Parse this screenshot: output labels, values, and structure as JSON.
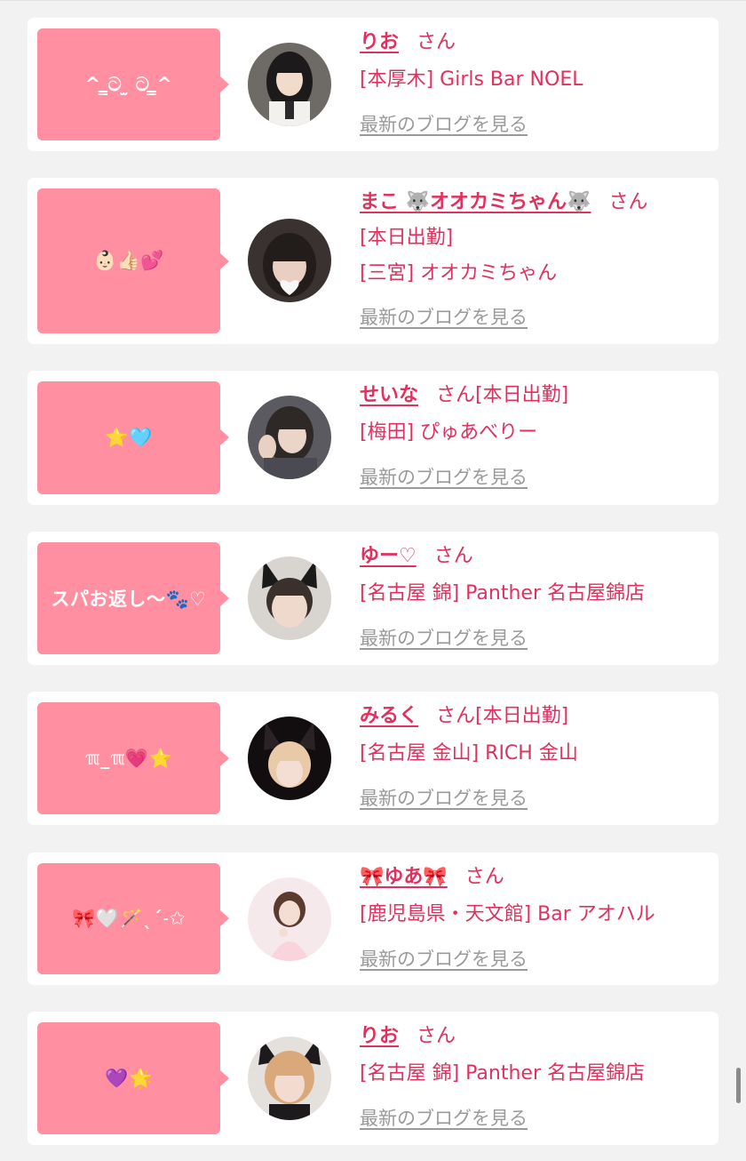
{
  "colors": {
    "page_bg": "#f2f2f2",
    "card_bg": "#ffffff",
    "bubble_bg": "#ff8fa1",
    "name_color": "#e0305e",
    "blog_link_color": "#9a9a9a"
  },
  "cards": [
    {
      "status_message": "^ ̳ට ̫ ට ̳^",
      "avatar_icon": "photo-avatar",
      "name": "りお",
      "honorific": "さん",
      "meta_lines": [
        "[本厚木] Girls Bar NOEL"
      ],
      "blog_link": "最新のブログを見る"
    },
    {
      "status_message": "👶🏻👍🏻💕",
      "avatar_icon": "photo-avatar",
      "name": "まこ 🐺オオカミちゃん🐺",
      "honorific": "さん",
      "meta_lines": [
        "[本日出勤]",
        "[三宮] オオカミちゃん"
      ],
      "blog_link": "最新のブログを見る"
    },
    {
      "status_message": "⭐️🩵",
      "avatar_icon": "photo-avatar",
      "name": "せいな",
      "honorific": "さん[本日出勤]",
      "meta_lines": [
        "[梅田] ぴゅあべりー"
      ],
      "blog_link": "最新のブログを見る"
    },
    {
      "status_message": "スパお返し〜🐾♡",
      "avatar_icon": "photo-avatar",
      "name": "ゆー♡",
      "honorific": "さん",
      "meta_lines": [
        "[名古屋 錦] Panther 名古屋錦店"
      ],
      "blog_link": "最新のブログを見る"
    },
    {
      "status_message": "ℼ_ℼ💗⭐️",
      "avatar_icon": "photo-avatar",
      "name": "みるく",
      "honorific": "さん[本日出勤]",
      "meta_lines": [
        "[名古屋 金山] RICH 金山"
      ],
      "blog_link": "最新のブログを見る"
    },
    {
      "status_message": "🎀🤍🪄ˎˊ˗✩",
      "avatar_icon": "photo-avatar",
      "name": "🎀ゆあ🎀",
      "honorific": "さん",
      "meta_lines": [
        "[鹿児島県・天文館] Bar アオハル"
      ],
      "blog_link": "最新のブログを見る"
    },
    {
      "status_message": "💜🌟",
      "avatar_icon": "photo-avatar",
      "name": "りお",
      "honorific": "さん",
      "meta_lines": [
        "[名古屋 錦] Panther 名古屋錦店"
      ],
      "blog_link": "最新のブログを見る"
    }
  ]
}
